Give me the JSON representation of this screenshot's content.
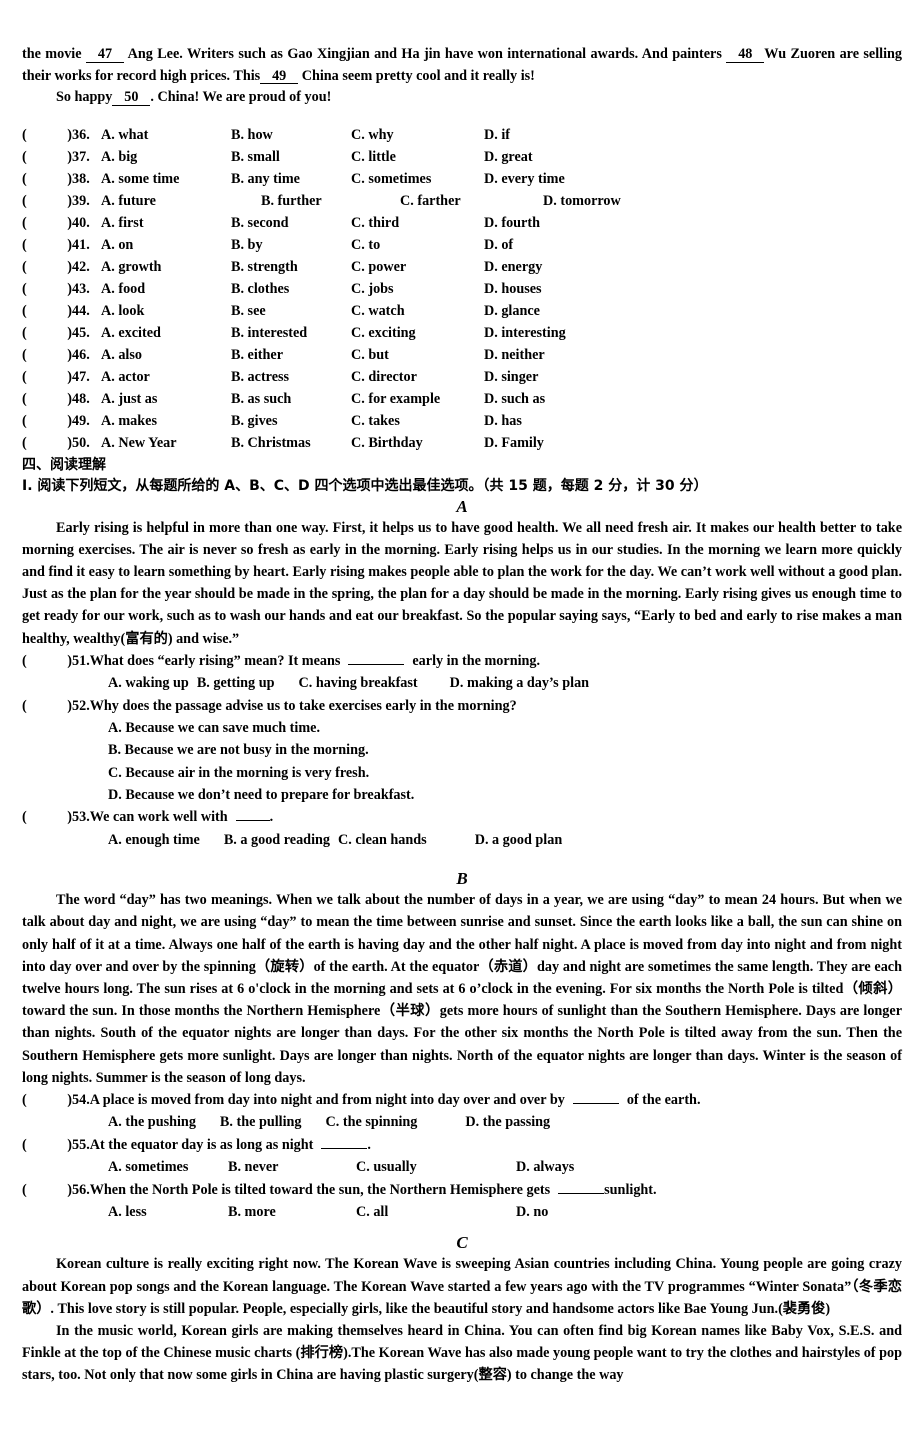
{
  "cloze_tail": {
    "line1_a": "the movie",
    "blank47": "47",
    "line1_b": "Ang Lee. Writers such as Gao Xingjian and Ha jin have won international awards. And painters",
    "blank48": "48",
    "line1_c": "Wu Zuoren are selling their works for record high prices. This",
    "blank49": "49",
    "line1_d": "China seem pretty cool and it really is!",
    "line2_a": "So happy",
    "blank50": "50",
    "line2_b": ". China! We are proud of you!"
  },
  "cloze_options": [
    {
      "num": "36.",
      "a": "A. what",
      "b": "B. how",
      "c": "C. why",
      "d": "D. if"
    },
    {
      "num": "37.",
      "a": "A. big",
      "b": "B. small",
      "c": "C. little",
      "d": "D. great"
    },
    {
      "num": "38.",
      "a": "A. some time",
      "b": "B. any time",
      "c": "C. sometimes",
      "d": "D. every time"
    },
    {
      "num": "39.",
      "a": "A. future",
      "b": "B. further",
      "c": "C. farther",
      "d": "D. tomorrow"
    },
    {
      "num": "40.",
      "a": "A. first",
      "b": "B. second",
      "c": "C. third",
      "d": "D. fourth"
    },
    {
      "num": "41.",
      "a": "A. on",
      "b": "B. by",
      "c": "C. to",
      "d": "D. of"
    },
    {
      "num": "42.",
      "a": "A. growth",
      "b": "B. strength",
      "c": "C. power",
      "d": "D. energy"
    },
    {
      "num": "43.",
      "a": "A. food",
      "b": "B. clothes",
      "c": "C. jobs",
      "d": "D. houses"
    },
    {
      "num": "44.",
      "a": "A. look",
      "b": "B. see",
      "c": "C. watch",
      "d": "D. glance"
    },
    {
      "num": "45.",
      "a": "A. excited",
      "b": "B. interested",
      "c": "C. exciting",
      "d": "D. interesting"
    },
    {
      "num": "46.",
      "a": "A. also",
      "b": "B. either",
      "c": "C. but",
      "d": "D. neither"
    },
    {
      "num": "47.",
      "a": "A. actor",
      "b": "B. actress",
      "c": "C. director",
      "d": "D. singer"
    },
    {
      "num": "48.",
      "a": "A. just as",
      "b": "B. as such",
      "c": "C. for example",
      "d": "D. such as"
    },
    {
      "num": "49.",
      "a": "A. makes",
      "b": "B. gives",
      "c": "C. takes",
      "d": "D. has"
    },
    {
      "num": "50.",
      "a": "A. New Year",
      "b": "B. Christmas",
      "c": "C. Birthday",
      "d": "D. Family"
    }
  ],
  "section": {
    "heading": "四、阅读理解",
    "instruction": "I. 阅读下列短文，从每题所给的 A、B、C、D 四个选项中选出最佳选项。（共 15 题，每题 2 分，计 30 分）"
  },
  "passage_a": {
    "label": "A",
    "body": "Early rising is helpful in more than one way. First, it helps us to have good health. We all need fresh air. It makes our health better to take morning exercises. The air is never so fresh as early in the morning. Early rising helps us in our studies. In the morning we learn more quickly and find it easy to learn something by heart. Early rising makes people able to plan the work for the day. We can’t work well without a good plan. Just as the plan for the year should be made in the spring, the plan for a day should be made in the morning. Early rising gives us enough time to get ready for our work, such as to wash our hands and eat our breakfast. So the popular saying says, “Early to bed and early to rise makes a man healthy, wealthy(富有的) and wise.”"
  },
  "questions_a": {
    "q51": {
      "num": "51.",
      "stem_a": "What does “early rising” mean?  It means",
      "stem_b": "early in the morning.",
      "a": "A. waking up",
      "b": "B. getting up",
      "c": "C. having breakfast",
      "d": "D. making a day’s plan"
    },
    "q52": {
      "num": "52.",
      "stem": "Why does the passage advise us to take exercises early in the morning?",
      "a": "A. Because we can save much time.",
      "b": "B. Because we are not busy in the morning.",
      "c": "C. Because air in the morning is very fresh.",
      "d": "D. Because we don’t need to prepare for breakfast."
    },
    "q53": {
      "num": "53.",
      "stem_a": "We can work well with",
      "stem_b": ".",
      "a": "A. enough time",
      "b": "B. a good reading",
      "c": "C. clean hands",
      "d": "D. a good plan"
    }
  },
  "passage_b": {
    "label": "B",
    "body": "The word “day” has two meanings. When we talk about the number of days in a year, we are using “day” to mean 24 hours. But when we talk about day and night, we are using “day” to mean the time between sunrise and sunset. Since the earth looks like a ball, the sun can shine on only half of it at a time. Always one half of the earth is having day and the other half night. A place is moved from day into night and from night into day over and over by the spinning（旋转）of the earth. At the equator（赤道）day and night are sometimes the same length. They are each twelve hours long. The sun rises at 6 o'clock in the morning and sets at 6 o’clock in the evening. For six months the North Pole is tilted（倾斜）toward the sun. In those months the Northern Hemisphere（半球）gets more hours of sunlight than the Southern Hemisphere. Days are longer than nights. South of the equator nights are longer than days. For the other six months the North Pole is tilted away from the sun. Then the Southern Hemisphere gets more sunlight. Days are longer than nights. North of the equator nights are longer than days. Winter is the season of long nights. Summer is the season of long days."
  },
  "questions_b": {
    "q54": {
      "num": "54.",
      "stem_a": "A place is moved from day into night and from night into day over and over by",
      "stem_b": "of the earth.",
      "a": "A. the pushing",
      "b": "B. the pulling",
      "c": "C. the spinning",
      "d": "D. the passing"
    },
    "q55": {
      "num": "55.",
      "stem_a": "At the equator day is as long as night",
      "stem_b": ".",
      "a": "A. sometimes",
      "b": "B. never",
      "c": "C. usually",
      "d": "D. always"
    },
    "q56": {
      "num": "56.",
      "stem_a": "When the North Pole is tilted toward the sun, the Northern Hemisphere gets",
      "stem_b": "sunlight.",
      "a": "A. less",
      "b": "B. more",
      "c": "C. all",
      "d": "D. no"
    }
  },
  "passage_c": {
    "label": "C",
    "para1": "Korean culture is really exciting right now. The Korean Wave is sweeping Asian countries including China. Young people are going crazy about Korean pop songs and the Korean language. The Korean Wave started a few years ago with the TV programmes “Winter Sonata”（冬季恋歌）. This love story is still popular. People, especially girls, like the beautiful story and handsome actors like Bae Young Jun.(裴勇俊)",
    "para2": "In the music world, Korean girls are making themselves heard in China. You can often find big Korean names like Baby Vox, S.E.S. and Finkle at the top of the Chinese music charts (排行榜).The Korean Wave has also made young people want to try the clothes and hairstyles of pop stars, too. Not only that now some girls in China are having plastic surgery(整容) to change the way"
  }
}
